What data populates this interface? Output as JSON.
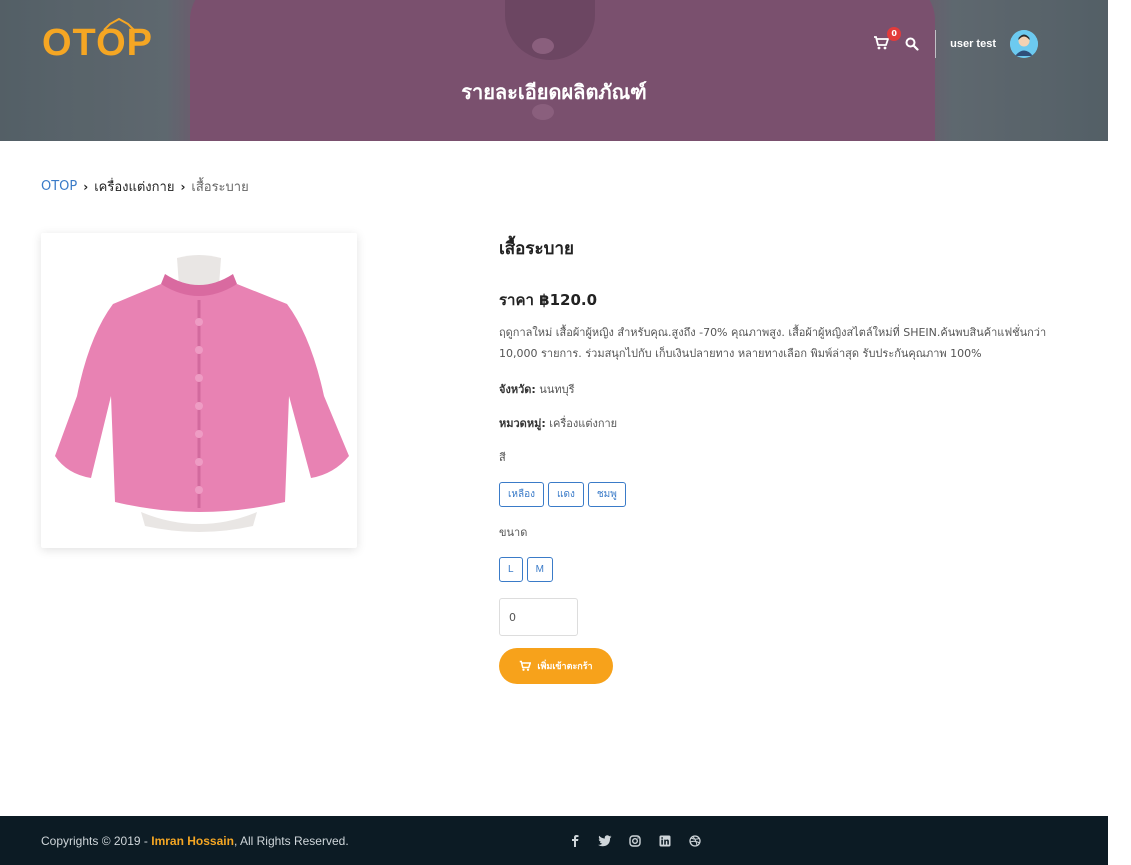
{
  "header": {
    "logo_text": "OTOP",
    "page_title": "รายละเอียดผลิตภัณฑ์",
    "cart_count": "0",
    "user_name": "user test"
  },
  "breadcrumb": {
    "home": "OTOP",
    "category": "เครื่องแต่งกาย",
    "current": "เสื้อระบาย"
  },
  "product": {
    "name": "เสื้อระบาย",
    "price": "ราคา ฿120.0",
    "description": "ฤดูกาลใหม่ เสื้อผ้าผู้หญิง สำหรับคุณ.สูงถึง -70% คุณภาพสูง. เสื้อผ้าผู้หญิงสไตล์ใหม่ที่ SHEIN.ค้นพบสินค้าแฟชั่นกว่า 10,000 รายการ. ร่วมสนุกไปกับ เก็บเงินปลายทาง หลายทางเลือก พิมพ์ล่าสุด รับประกันคุณภาพ 100%",
    "province_label": "จังหวัด:",
    "province_value": "นนทบุรี",
    "category_label": "หมวดหมู่:",
    "category_value": "เครื่องแต่งกาย",
    "color_label": "สี",
    "colors": [
      "เหลือง",
      "แดง",
      "ชมพู"
    ],
    "size_label": "ขนาด",
    "sizes": [
      "L",
      "M"
    ],
    "quantity_value": "0",
    "add_to_cart_label": "เพิ่มเข้าตะกร้า"
  },
  "footer": {
    "copyright_prefix": "Copyrights © 2019 - ",
    "copyright_author": "Imran Hossain",
    "copyright_suffix": ", All Rights Reserved.",
    "social_icons": [
      "facebook-icon",
      "twitter-icon",
      "instagram-icon",
      "linkedin-icon",
      "dribbble-icon"
    ]
  },
  "colors": {
    "accent": "#f7a21b",
    "link": "#3a7bc8",
    "footer_bg": "#0c1b24",
    "badge": "#e23b3b"
  }
}
